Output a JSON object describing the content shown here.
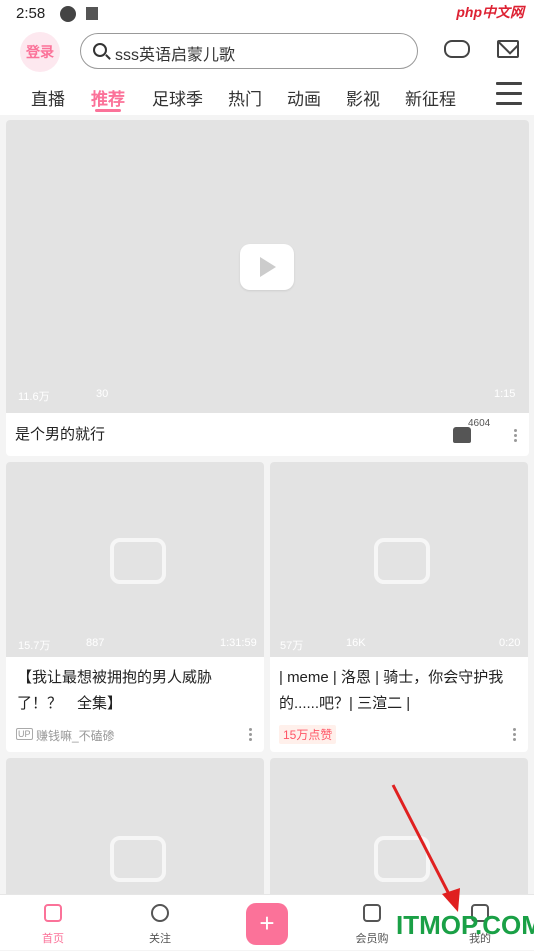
{
  "status_bar": {
    "time": "2:58",
    "watermark": "php中文网"
  },
  "header": {
    "login_label": "登录",
    "search_placeholder": "sss英语启蒙儿歌",
    "tabs": [
      "直播",
      "推荐",
      "足球季",
      "热门",
      "动画",
      "影视",
      "新征程"
    ],
    "active_tab": "推荐"
  },
  "feed": {
    "featured": {
      "views": "11.6万",
      "comments": "30",
      "duration": "1:15",
      "title": "是个男的就行",
      "likes": "4604"
    },
    "cards": [
      {
        "views": "15.7万",
        "comments": "887",
        "duration": "1:31:59",
        "title_line1": "【我让最想被拥抱的男人威胁",
        "title_line2": "了！？　全集】",
        "up_badge": "UP",
        "uploader": "赚钱嘛_不磕碜"
      },
      {
        "views": "57万",
        "comments": "16K",
        "duration": "0:20",
        "title_line1": "| meme | 洛恩 | 骑士，你会守护我",
        "title_line2": "的......吧？| 三渲二 |",
        "badge": "15万点赞"
      }
    ]
  },
  "bottom_nav": {
    "items": [
      "首页",
      "关注",
      "",
      "会员购",
      "我的"
    ],
    "publish_label": "+"
  },
  "watermark": "ITMOP.COM",
  "colors": {
    "accent": "#fb7299",
    "arrow": "#e02020",
    "watermark": "#1aa046"
  }
}
